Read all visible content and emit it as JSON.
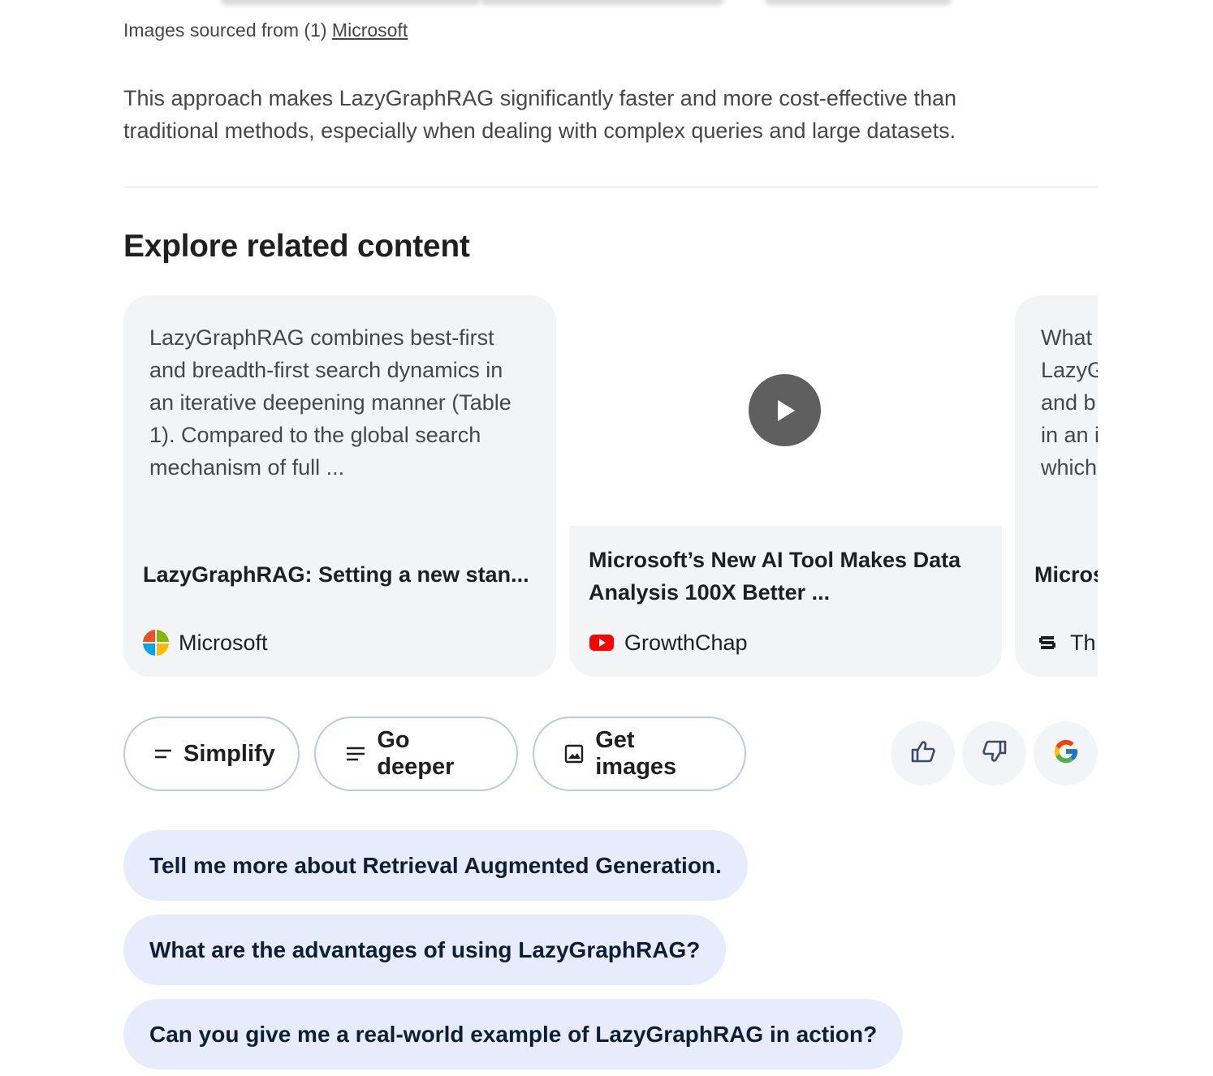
{
  "sources": {
    "prefix": "Images sourced from (1) ",
    "link": "Microsoft"
  },
  "paragraph": "This approach makes LazyGraphRAG significantly faster and more cost-effective than traditional methods, especially when dealing with complex queries and large datasets.",
  "section_title": "Explore related content",
  "cards": [
    {
      "snippet": "LazyGraphRAG combines best-first and breadth-first search dynamics in an iterative deepening manner (Table 1). Compared to the global search mechanism of full ...",
      "title": "LazyGraphRAG: Setting a new stan...",
      "source": "Microsoft",
      "icon": "microsoft-logo-icon"
    },
    {
      "title": "Microsoft’s New AI Tool Makes Data Analysis 100X Better ...",
      "source": "GrowthChap",
      "icon": "youtube-icon"
    },
    {
      "snippet": "What LazyG and b in an i which",
      "title": "Micros",
      "source": "Th",
      "icon": "site-s-icon"
    }
  ],
  "actions": {
    "simplify": "Simplify",
    "go_deeper": "Go deeper",
    "get_images": "Get images"
  },
  "feedback": {
    "thumbs_up": "thumbs-up-icon",
    "thumbs_down": "thumbs-down-icon",
    "google": "google-logo-icon"
  },
  "suggestions": [
    "Tell me more about Retrieval Augmented Generation.",
    "What are the advantages of using LazyGraphRAG?",
    "Can you give me a real-world example of LazyGraphRAG in action?"
  ],
  "colors": {
    "card_bg": "#f3f4f6",
    "pill_border": "#b9c9ec",
    "suggestion_bg": "#e6ecfb",
    "play_bg": "#5f5f5f"
  }
}
